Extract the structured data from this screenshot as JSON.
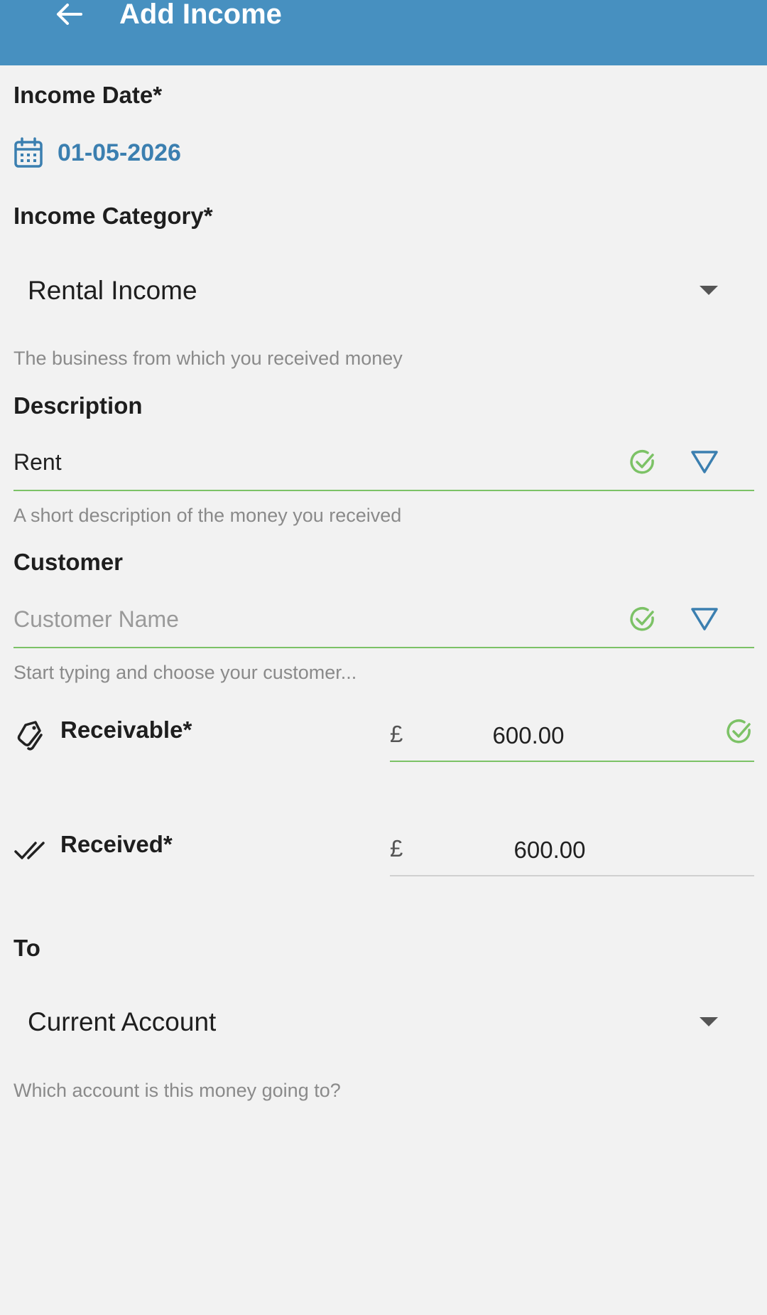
{
  "appbar": {
    "title": "Add Income",
    "back_icon": "arrow-left-icon"
  },
  "income_date": {
    "label": "Income Date*",
    "value": "01-05-2026",
    "icon": "calendar-icon"
  },
  "income_category": {
    "label": "Income Category*",
    "selected": "Rental Income",
    "hint": "The business from which you received money"
  },
  "description": {
    "label": "Description",
    "value": "Rent",
    "hint": "A short description of the money you received"
  },
  "customer": {
    "label": "Customer",
    "value": "",
    "placeholder": "Customer Name",
    "hint": "Start typing and choose your customer..."
  },
  "receivable": {
    "label": "Receivable*",
    "currency": "£",
    "value": "600.00",
    "icon": "tag-icon"
  },
  "received": {
    "label": "Received*",
    "currency": "£",
    "value": "600.00",
    "icon": "double-check-icon"
  },
  "to_account": {
    "label": "To",
    "selected": "Current Account",
    "hint": "Which account is this money going to?"
  },
  "colors": {
    "appbar": "#4790c0",
    "accent_blue": "#3b7fb0",
    "valid_green": "#7cc266",
    "background": "#f2f2f2"
  }
}
